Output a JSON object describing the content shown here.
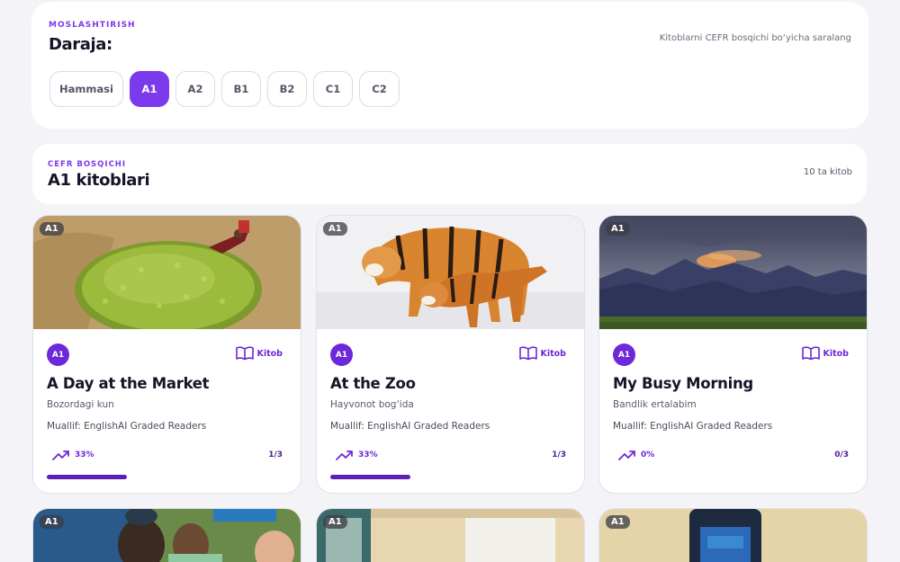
{
  "filter": {
    "eyebrow": "MOSLASHTIRISH",
    "title": "Daraja:",
    "hint": "Kitoblarni CEFR bosqichi bo‘yicha saralang",
    "levels": [
      "Hammasi",
      "A1",
      "A2",
      "B1",
      "B2",
      "C1",
      "C2"
    ],
    "selected": "A1"
  },
  "section": {
    "eyebrow": "CEFR BOSQICHI",
    "title": "A1 kitoblari",
    "count": "10 ta kitob"
  },
  "books": [
    {
      "level": "A1",
      "type": "Kitob",
      "title": "A Day at the Market",
      "subtitle": "Bozordagi kun",
      "author": "Muallif: EnglishAI Graded Readers",
      "progress_label": "33%",
      "progress": 0.33,
      "count": "1/3",
      "image": "market-photo"
    },
    {
      "level": "A1",
      "type": "Kitob",
      "title": "At the Zoo",
      "subtitle": "Hayvonot bog‘ida",
      "author": "Muallif: EnglishAI Graded Readers",
      "progress_label": "33%",
      "progress": 0.33,
      "count": "1/3",
      "image": "tiger-photo"
    },
    {
      "level": "A1",
      "type": "Kitob",
      "title": "My Busy Morning",
      "subtitle": "Bandlik ertalabim",
      "author": "Muallif: EnglishAI Graded Readers",
      "progress_label": "0%",
      "progress": 0,
      "count": "0/3",
      "image": "mountain-photo"
    }
  ],
  "more_books": [
    {
      "level": "A1",
      "image": "family-photo"
    },
    {
      "level": "A1",
      "image": "room-photo"
    },
    {
      "level": "A1",
      "image": "backpack-photo"
    }
  ],
  "colors": {
    "accent": "#7c3aed",
    "accent_dark": "#5b21b6",
    "background": "#f4f4f8"
  }
}
